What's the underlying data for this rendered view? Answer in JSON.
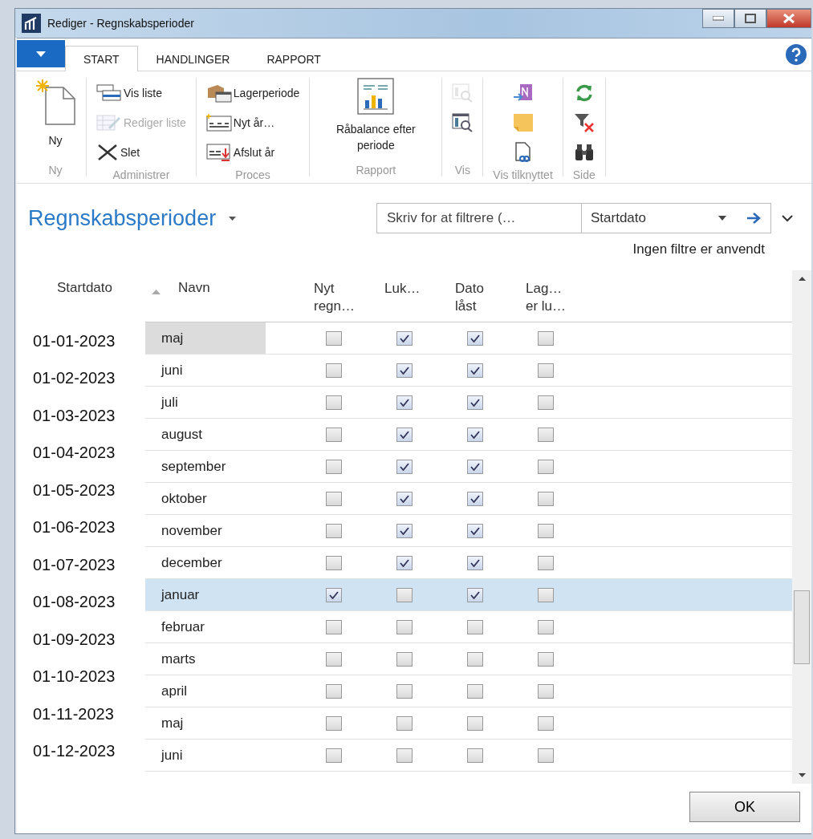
{
  "window": {
    "title": "Rediger - Regnskabsperioder"
  },
  "ribbon_tabs": [
    {
      "label": "START",
      "selected": true
    },
    {
      "label": "HANDLINGER",
      "selected": false
    },
    {
      "label": "RAPPORT",
      "selected": false
    }
  ],
  "ribbon_groups": [
    {
      "label": "Ny",
      "kind": "large",
      "items": [
        {
          "label": "Ny",
          "disabled": false
        }
      ]
    },
    {
      "label": "Administrer",
      "kind": "small",
      "items": [
        {
          "label": "Vis liste",
          "disabled": false
        },
        {
          "label": "Rediger liste",
          "disabled": true
        },
        {
          "label": "Slet",
          "disabled": false
        }
      ]
    },
    {
      "label": "Proces",
      "kind": "small",
      "items": [
        {
          "label": "Lagerperiode",
          "disabled": false
        },
        {
          "label": "Nyt år…",
          "disabled": false
        },
        {
          "label": "Afslut år",
          "disabled": false
        }
      ]
    },
    {
      "label": "Rapport",
      "kind": "large",
      "items": [
        {
          "label": "Råbalance efter periode",
          "disabled": false
        }
      ]
    },
    {
      "label": "Vis",
      "kind": "icons",
      "items": [
        {
          "disabled": true
        },
        {
          "disabled": false
        }
      ]
    },
    {
      "label": "Vis tilknyttet",
      "kind": "icons",
      "items": [
        {
          "disabled": false
        },
        {
          "disabled": false
        },
        {
          "disabled": false
        }
      ]
    },
    {
      "label": "Side",
      "kind": "icons",
      "items": [
        {
          "disabled": false
        },
        {
          "disabled": false
        },
        {
          "disabled": false
        }
      ]
    }
  ],
  "page": {
    "title": "Regnskabsperioder",
    "filter": {
      "placeholder": "Skriv for at filtrere (…",
      "field": "Startdato"
    },
    "filter_status": "Ingen filtre er anvendt"
  },
  "table": {
    "columns": [
      "Startdato",
      "Navn",
      "Nyt regn…",
      "Luk…",
      "Dato låst",
      "Lag… er lu…"
    ],
    "start_dates": [
      "01-01-2023",
      "01-02-2023",
      "01-03-2023",
      "01-04-2023",
      "01-05-2023",
      "01-06-2023",
      "01-07-2023",
      "01-08-2023",
      "01-09-2023",
      "01-10-2023",
      "01-11-2023",
      "01-12-2023"
    ],
    "rows": [
      {
        "name": "maj",
        "focused": true,
        "selected": false,
        "checks": [
          false,
          true,
          true,
          false
        ]
      },
      {
        "name": "juni",
        "focused": false,
        "selected": false,
        "checks": [
          false,
          true,
          true,
          false
        ]
      },
      {
        "name": "juli",
        "focused": false,
        "selected": false,
        "checks": [
          false,
          true,
          true,
          false
        ]
      },
      {
        "name": "august",
        "focused": false,
        "selected": false,
        "checks": [
          false,
          true,
          true,
          false
        ]
      },
      {
        "name": "september",
        "focused": false,
        "selected": false,
        "checks": [
          false,
          true,
          true,
          false
        ]
      },
      {
        "name": "oktober",
        "focused": false,
        "selected": false,
        "checks": [
          false,
          true,
          true,
          false
        ]
      },
      {
        "name": "november",
        "focused": false,
        "selected": false,
        "checks": [
          false,
          true,
          true,
          false
        ]
      },
      {
        "name": "december",
        "focused": false,
        "selected": false,
        "checks": [
          false,
          true,
          true,
          false
        ]
      },
      {
        "name": "januar",
        "focused": false,
        "selected": true,
        "checks": [
          true,
          false,
          true,
          false
        ]
      },
      {
        "name": "februar",
        "focused": false,
        "selected": false,
        "checks": [
          false,
          false,
          false,
          false
        ]
      },
      {
        "name": "marts",
        "focused": false,
        "selected": false,
        "checks": [
          false,
          false,
          false,
          false
        ]
      },
      {
        "name": "april",
        "focused": false,
        "selected": false,
        "checks": [
          false,
          false,
          false,
          false
        ]
      },
      {
        "name": "maj",
        "focused": false,
        "selected": false,
        "checks": [
          false,
          false,
          false,
          false
        ]
      },
      {
        "name": "juni",
        "focused": false,
        "selected": false,
        "checks": [
          false,
          false,
          false,
          false
        ]
      }
    ]
  },
  "buttons": [
    "OK"
  ]
}
